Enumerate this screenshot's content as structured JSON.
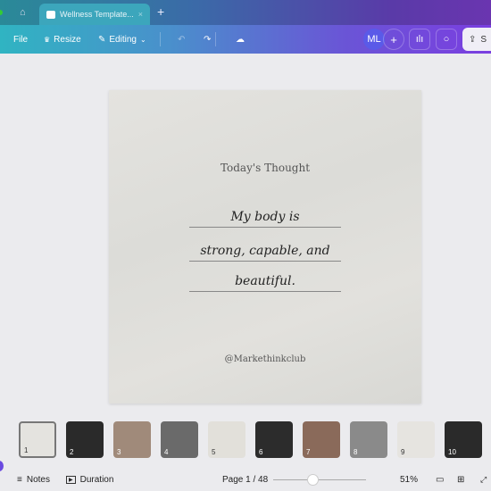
{
  "tabbar": {
    "tab_title": "Wellness Template...",
    "close": "×",
    "new_tab": "+"
  },
  "toolbar": {
    "file": "File",
    "resize": "Resize",
    "editing": "Editing",
    "avatar": "ML",
    "add": "+",
    "share": "S"
  },
  "canvas": {
    "title": "Today's Thought",
    "quote_lines": [
      "My body is",
      "strong, capable, and",
      "beautiful."
    ],
    "handle": "@Markethinkclub"
  },
  "thumbnails": [
    {
      "n": "1",
      "bg": "#e4e3df",
      "light": true
    },
    {
      "n": "2",
      "bg": "#2a2a2a"
    },
    {
      "n": "3",
      "bg": "#a08a7a"
    },
    {
      "n": "4",
      "bg": "#6a6a6a"
    },
    {
      "n": "5",
      "bg": "#e2e0da",
      "light": true
    },
    {
      "n": "6",
      "bg": "#2c2c2c"
    },
    {
      "n": "7",
      "bg": "#8a6a5a"
    },
    {
      "n": "8",
      "bg": "#8a8a8a"
    },
    {
      "n": "9",
      "bg": "#e6e4e0",
      "light": true
    },
    {
      "n": "10",
      "bg": "#2a2a2a"
    }
  ],
  "bottombar": {
    "notes": "Notes",
    "duration": "Duration",
    "page": "Page 1 / 48",
    "zoom_percent": "51%",
    "zoom_slider_value": 0.42
  }
}
